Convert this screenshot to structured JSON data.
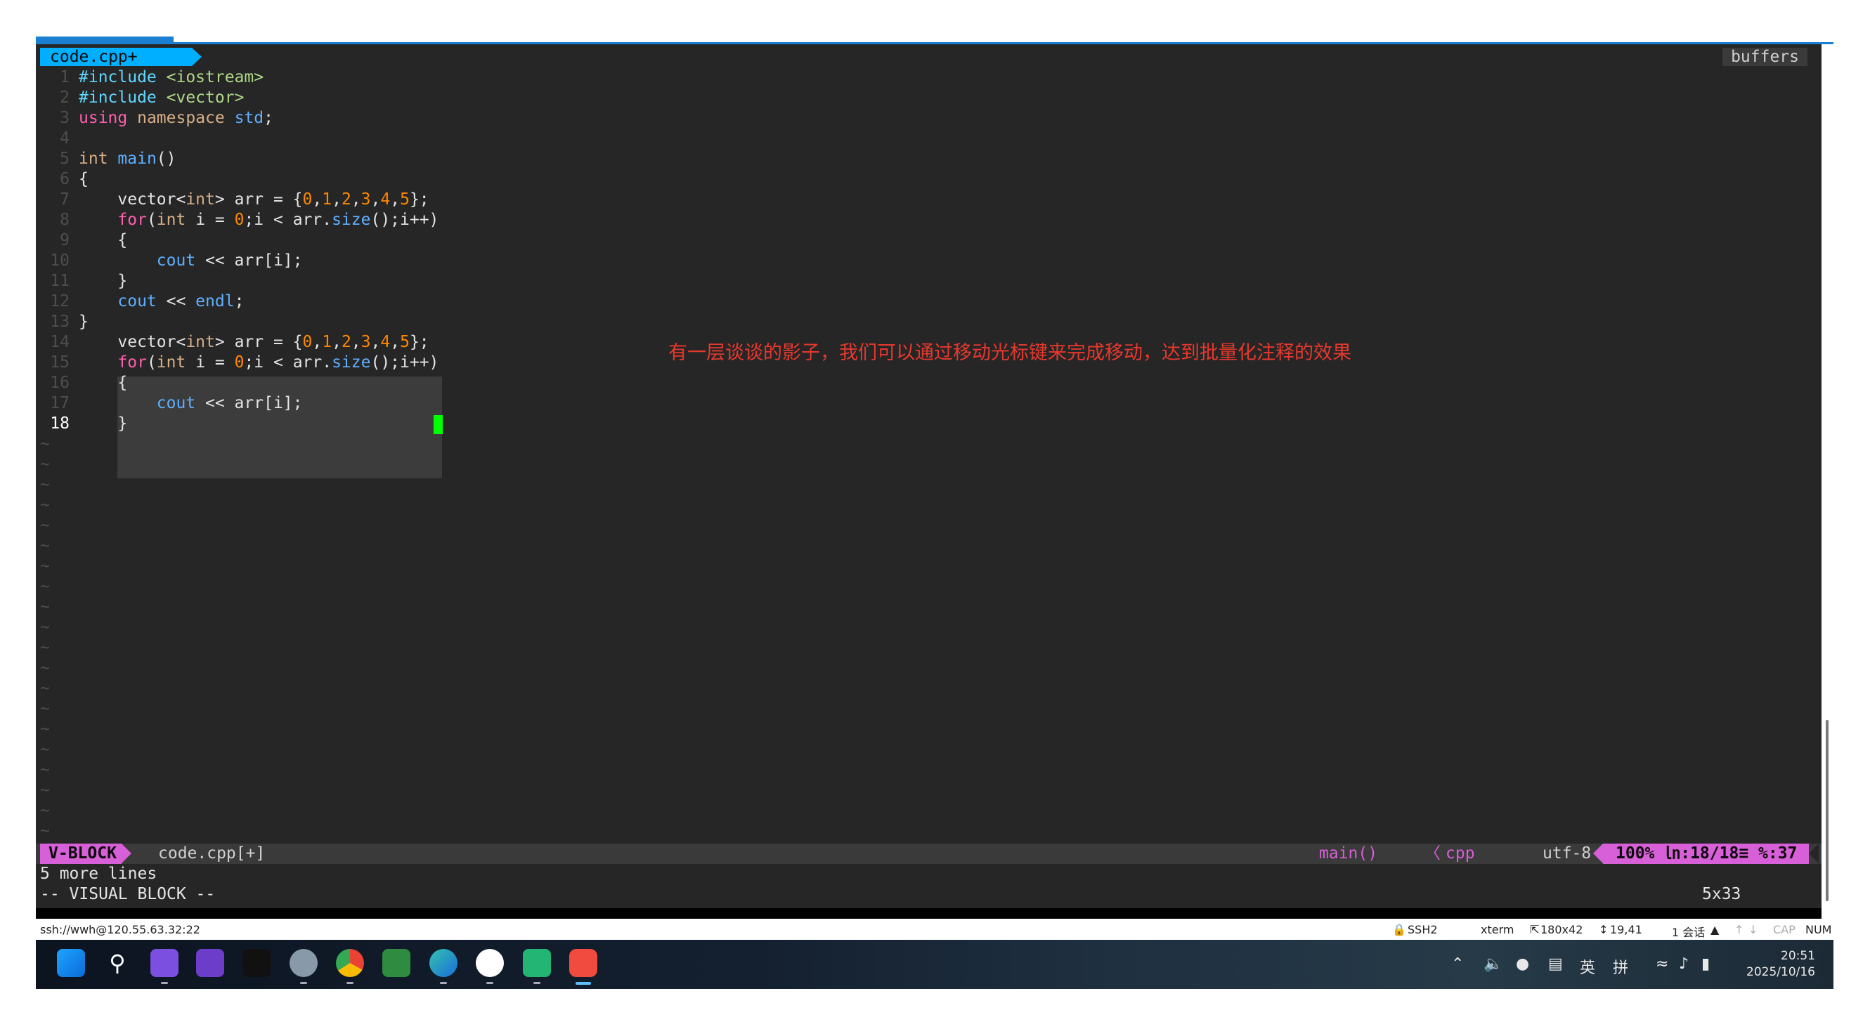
{
  "tabline": {
    "tab_label": "code.cpp+",
    "buffers_label": "buffers"
  },
  "editor": {
    "lines": [
      {
        "num": "1",
        "text": "#include <iostream>"
      },
      {
        "num": "2",
        "text": "#include <vector>"
      },
      {
        "num": "3",
        "text": "using namespace std;"
      },
      {
        "num": "4",
        "text": ""
      },
      {
        "num": "5",
        "text": "int main()"
      },
      {
        "num": "6",
        "text": "{"
      },
      {
        "num": "7",
        "text": "    vector<int> arr = {0,1,2,3,4,5};"
      },
      {
        "num": "8",
        "text": "    for(int i = 0;i < arr.size();i++)"
      },
      {
        "num": "9",
        "text": "    {"
      },
      {
        "num": "10",
        "text": "        cout << arr[i];"
      },
      {
        "num": "11",
        "text": "    }"
      },
      {
        "num": "12",
        "text": "    cout << endl;"
      },
      {
        "num": "13",
        "text": "}"
      },
      {
        "num": "14",
        "text": "    vector<int> arr = {0,1,2,3,4,5};"
      },
      {
        "num": "15",
        "text": "    for(int i = 0;i < arr.size();i++)"
      },
      {
        "num": "16",
        "text": "    {"
      },
      {
        "num": "17",
        "text": "        cout << arr[i];"
      },
      {
        "num": "18",
        "text": "    }"
      }
    ],
    "empty_line_marker": "~"
  },
  "annotation": "有一层谈谈的影子，我们可以通过移动光标键来完成移动，达到批量化注释的效果",
  "statusline": {
    "mode": "V-BLOCK",
    "file": "code.cpp[+]",
    "function": "main()",
    "separator": "〈",
    "filetype": "cpp",
    "encoding": "utf-8",
    "position": "100% ㏑:18/18≡ %:37"
  },
  "messages": {
    "line1": "5 more lines",
    "line2": "-- VISUAL BLOCK --",
    "selection_size": "5x33"
  },
  "infobar": {
    "connection": "ssh://wwh@120.55.63.32:22",
    "protocol": "SSH2",
    "term": "xterm",
    "size": "180x42",
    "cursor": "19,41",
    "sessions": "1 会话",
    "cap": "CAP",
    "num": "NUM"
  },
  "taskbar": {
    "tray_lang": "英",
    "tray_ime": "拼",
    "time": "20:51",
    "date": "2025/10/16"
  },
  "colors": {
    "accent_blue": "#00afff",
    "mode_magenta": "#d75fd7",
    "cursor_green": "#00ff00",
    "annotation_red": "#e8382d"
  }
}
